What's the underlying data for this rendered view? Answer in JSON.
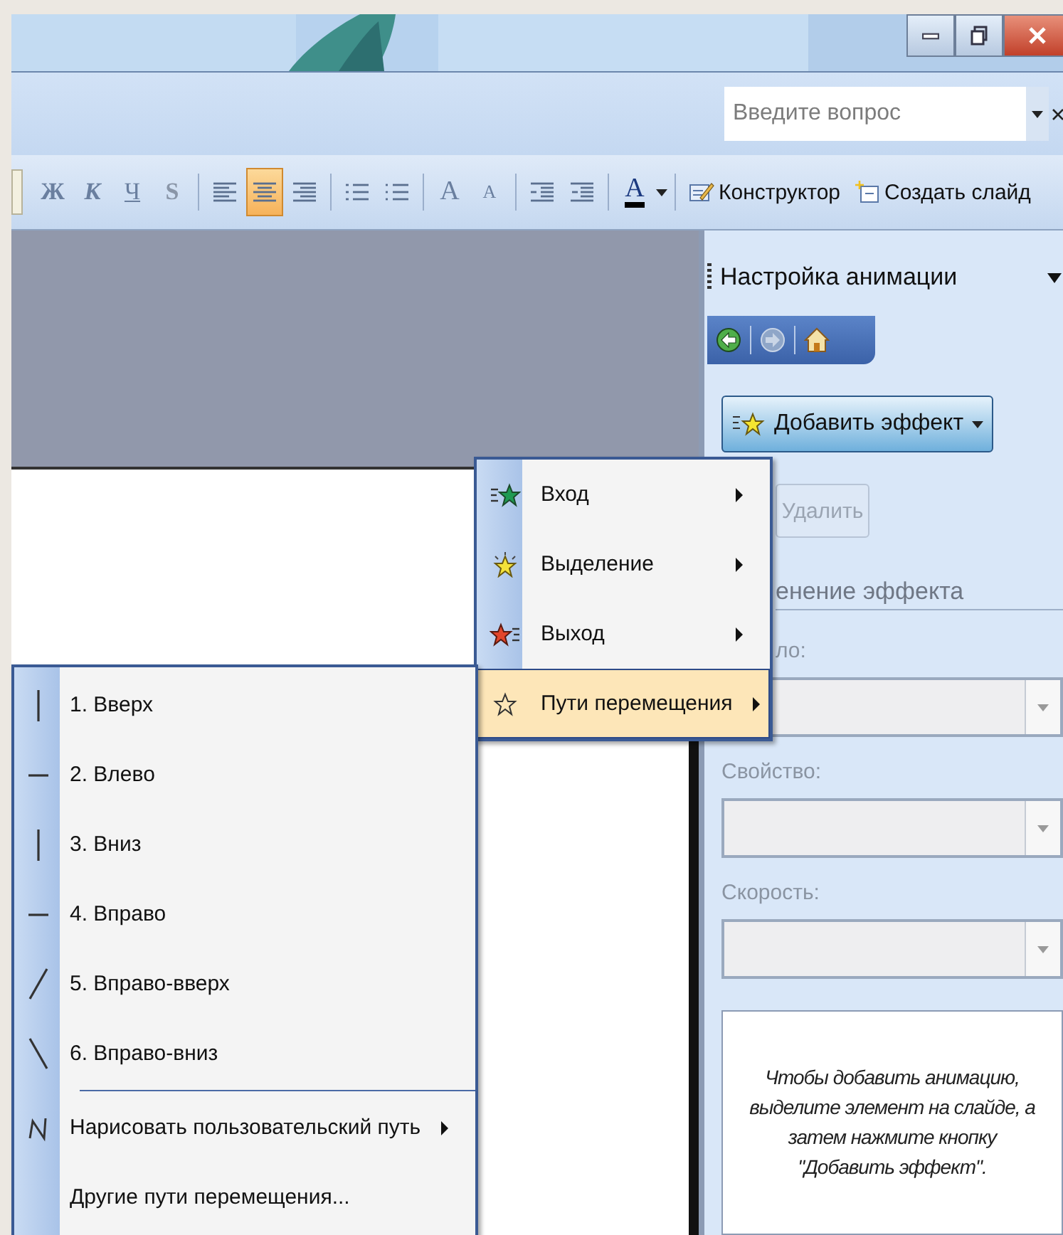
{
  "help_field": {
    "placeholder": "Введите вопрос"
  },
  "toolbar": {
    "buttons": [
      {
        "kind": "bold",
        "label": "Ж",
        "selected": false
      },
      {
        "kind": "italic",
        "label": "К",
        "selected": false
      },
      {
        "kind": "underline",
        "label": "Ч",
        "selected": false
      },
      {
        "kind": "shadow",
        "label": "S",
        "selected": false
      },
      {
        "kind": "align-left",
        "selected": false
      },
      {
        "kind": "align-center",
        "selected": true
      },
      {
        "kind": "align-right",
        "selected": false
      },
      {
        "kind": "numbered-list",
        "selected": false
      },
      {
        "kind": "bullet-list",
        "selected": false
      },
      {
        "kind": "grow-font",
        "label": "A",
        "selected": false
      },
      {
        "kind": "shrink-font",
        "label": "A",
        "selected": false
      },
      {
        "kind": "decrease-indent",
        "selected": false
      },
      {
        "kind": "increase-indent",
        "selected": false
      },
      {
        "kind": "font-color",
        "label": "A",
        "selected": false
      },
      {
        "kind": "designer",
        "label": "Конструктор",
        "selected": false
      },
      {
        "kind": "new-slide",
        "label": "Создать слайд",
        "selected": false
      }
    ]
  },
  "task_pane": {
    "title": "Настройка анимации",
    "add_effect_button": "Добавить эффект",
    "remove_button": {
      "label": "Удалить",
      "disabled": true
    },
    "section_heading": "енение эффекта",
    "fields": [
      {
        "label": "ло:",
        "disabled": true
      },
      {
        "label": "Свойство:",
        "disabled": true
      },
      {
        "label": "Скорость:",
        "disabled": true
      }
    ],
    "hint": "Чтобы добавить анимацию, выделите элемент на слайде, а затем нажмите кнопку \"Добавить эффект\"."
  },
  "effect_menu": {
    "items": [
      {
        "kind": "entrance",
        "label": "Вход",
        "submenu": true,
        "selected": false
      },
      {
        "kind": "emphasis",
        "label": "Выделение",
        "submenu": true,
        "selected": false
      },
      {
        "kind": "exit",
        "label": "Выход",
        "submenu": true,
        "selected": false
      },
      {
        "kind": "motion-path",
        "label": "Пути перемещения",
        "submenu": true,
        "selected": true
      }
    ]
  },
  "path_menu": {
    "paths": [
      {
        "kind": "up",
        "label": "1. Вверх"
      },
      {
        "kind": "left",
        "label": "2. Влево"
      },
      {
        "kind": "down",
        "label": "3. Вниз"
      },
      {
        "kind": "right",
        "label": "4. Вправо"
      },
      {
        "kind": "up-right",
        "label": "5. Вправо-вверх"
      },
      {
        "kind": "down-right",
        "label": "6. Вправо-вниз"
      }
    ],
    "other_items": [
      {
        "kind": "custom",
        "label": "Нарисовать пользовательский путь",
        "submenu": true
      },
      {
        "kind": "more",
        "label": "Другие пути перемещения...",
        "submenu": false
      }
    ]
  }
}
